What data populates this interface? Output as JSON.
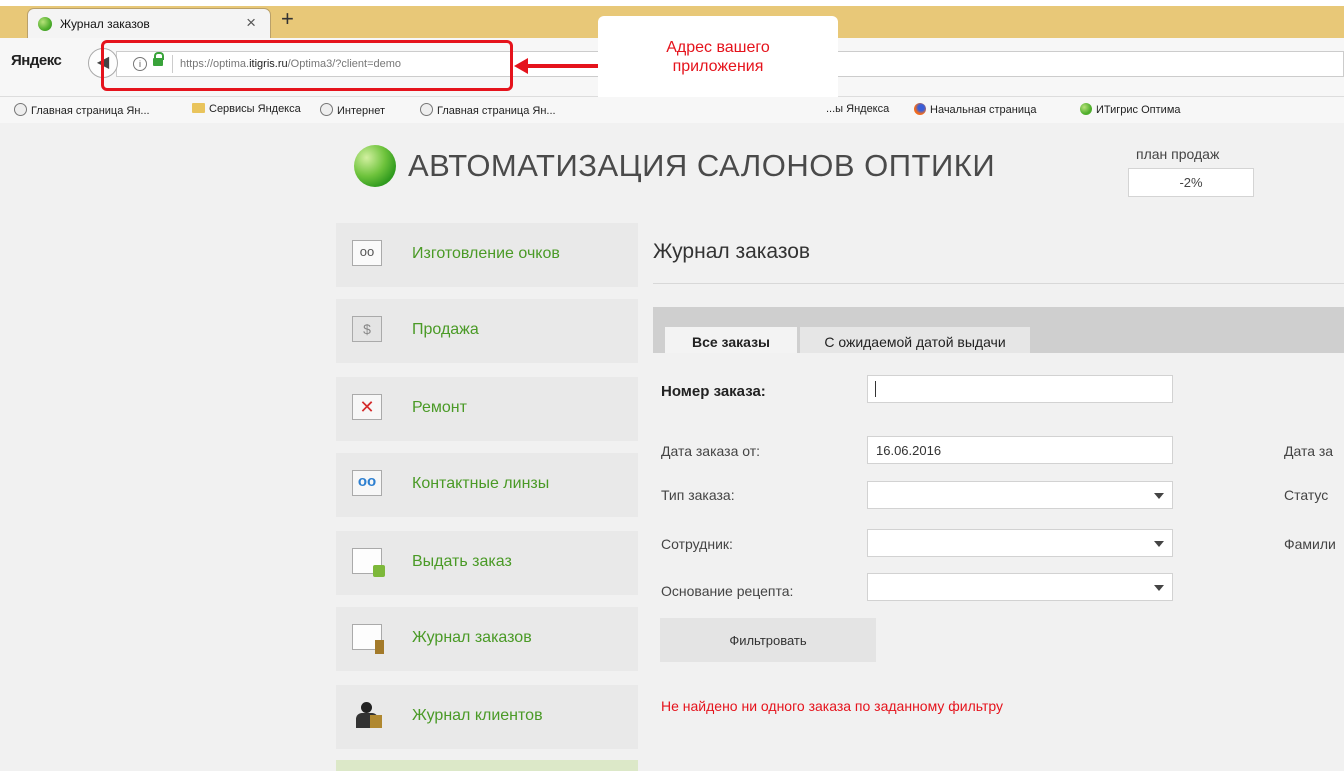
{
  "browser": {
    "tab_title": "Журнал заказов",
    "tab_close": "×",
    "new_tab": "+",
    "brand": "Яндекс",
    "url_prefix": "https://optima.",
    "url_domain": "itigris.ru",
    "url_path": "/Optima3/?client=demo",
    "callout_line1": "Адрес вашего",
    "callout_line2": "приложения",
    "bookmarks": [
      "Главная страница Ян...",
      "Сервисы Яндекса",
      "Интернет",
      "Главная страница Ян...",
      "...ы Яндекса",
      "Начальная страница",
      "ИТигрис Оптима"
    ],
    "annotation_color": "#e5131c"
  },
  "header": {
    "app_title": "АВТОМАТИЗАЦИЯ САЛОНОВ ОПТИКИ",
    "plan_label": "план продаж",
    "plan_value": "-2%"
  },
  "sidebar": {
    "items": [
      {
        "label": "Изготовление очков",
        "icon": "glasses-icon"
      },
      {
        "label": "Продажа",
        "icon": "sale-icon"
      },
      {
        "label": "Ремонт",
        "icon": "repair-icon"
      },
      {
        "label": "Контактные линзы",
        "icon": "contact-lenses-icon"
      },
      {
        "label": "Выдать заказ",
        "icon": "issue-order-icon"
      },
      {
        "label": "Журнал заказов",
        "icon": "orders-journal-icon"
      },
      {
        "label": "Журнал клиентов",
        "icon": "clients-journal-icon"
      }
    ],
    "accent_color": "#4a9a26"
  },
  "main": {
    "title": "Журнал заказов",
    "tabs": [
      {
        "label": "Все заказы",
        "active": true
      },
      {
        "label": "С ожидаемой датой выдачи",
        "active": false
      }
    ],
    "filters": {
      "order_number_label": "Номер заказа:",
      "order_number_value": "",
      "date_from_label": "Дата заказа от:",
      "date_from_value": "16.06.2016",
      "order_type_label": "Тип заказа:",
      "order_type_value": "",
      "employee_label": "Сотрудник:",
      "employee_value": "",
      "prescription_label": "Основание рецепта:",
      "prescription_value": "",
      "right_date_label": "Дата за",
      "right_status_label": "Статус",
      "right_surname_label": "Фамили"
    },
    "filter_button": "Фильтровать",
    "no_results": "Не найдено ни одного заказа по заданному фильтру"
  }
}
